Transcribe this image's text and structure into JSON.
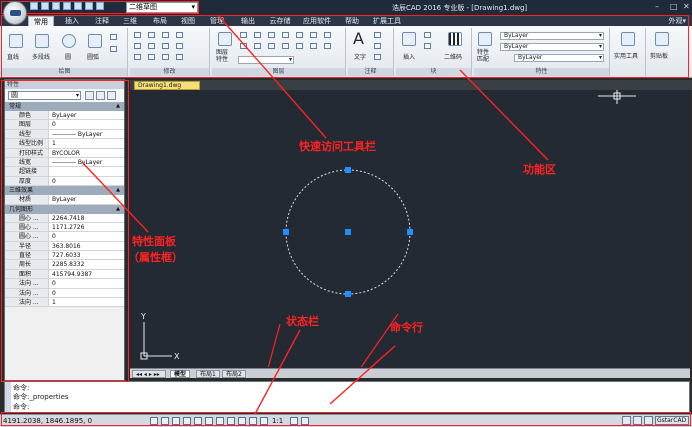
{
  "titlebar": {
    "workspace": "二维草图",
    "title": "浩辰CAD 2016 专业版 - [Drawing1.dwg]"
  },
  "tabs": [
    "常用",
    "插入",
    "注释",
    "三维",
    "布局",
    "视图",
    "管理",
    "输出",
    "云存储",
    "应用软件",
    "帮助",
    "扩展工具"
  ],
  "appearance": "外观▾",
  "ribbon": {
    "draw": {
      "line": "直线",
      "polyline": "多段线",
      "circle": "圆",
      "arc": "圆弧",
      "group_title": "绘图"
    },
    "modify": {
      "group_title": "修改"
    },
    "layers": {
      "layer_props": "图层\n特性",
      "group_title": "图层"
    },
    "annotation": {
      "text": "文字",
      "group_title": "注释"
    },
    "block": {
      "insert": "插入",
      "qrcode": "二维码",
      "group_title": "块"
    },
    "properties": {
      "match": "特性\n匹配",
      "bylayer1": "ByLayer",
      "bylayer2": "ByLayer",
      "bylayer3": "ByLayer",
      "group_title": "特性"
    },
    "utilities": {
      "label": "实用工具"
    },
    "clipboard": {
      "label": "剪贴板"
    }
  },
  "props": {
    "panel_title": "特性",
    "selection": "圆",
    "cat_general": "常规",
    "cat_3d": "三维效果",
    "cat_geometry": "几何图形",
    "general_rows": [
      {
        "k": "颜色",
        "v": "ByLayer"
      },
      {
        "k": "图层",
        "v": "0"
      },
      {
        "k": "线型",
        "v": "———— ByLayer"
      },
      {
        "k": "线型比例",
        "v": "1"
      },
      {
        "k": "打印样式",
        "v": "BYCOLOR"
      },
      {
        "k": "线宽",
        "v": "———— ByLayer"
      },
      {
        "k": "超链接",
        "v": ""
      },
      {
        "k": "厚度",
        "v": "0"
      }
    ],
    "three_d_rows": [
      {
        "k": "材质",
        "v": "ByLayer"
      }
    ],
    "geometry_rows": [
      {
        "k": "圆心 ...",
        "v": "2264.7418"
      },
      {
        "k": "圆心 ...",
        "v": "1171.2726"
      },
      {
        "k": "圆心 ...",
        "v": "0"
      },
      {
        "k": "半径",
        "v": "363.8016"
      },
      {
        "k": "直径",
        "v": "727.6033"
      },
      {
        "k": "周长",
        "v": "2285.8332"
      },
      {
        "k": "面积",
        "v": "415794.9387"
      },
      {
        "k": "法向 ...",
        "v": "0"
      },
      {
        "k": "法向 ...",
        "v": "0"
      },
      {
        "k": "法向 ...",
        "v": "1"
      }
    ]
  },
  "document": {
    "tab": "Drawing1.dwg"
  },
  "layout_tabs": [
    "模型",
    "布局1",
    "布局2"
  ],
  "command": {
    "line1": "命令:",
    "line2": "命令:_properties",
    "prompt": "命令:"
  },
  "status": {
    "coords": "4191.2038, 1846.1895, 0",
    "scale": "1:1",
    "brand": "GstarCAD"
  },
  "annotations": {
    "qat": "快速访问工具栏",
    "ribbon": "功能区",
    "props": "特性面板",
    "props2": "（属性框）",
    "statusbar": "状态栏",
    "cmdline": "命令行"
  },
  "colors": {
    "accent": "#ff2222",
    "canvas": "#242a33",
    "grip": "#1e90ff"
  }
}
